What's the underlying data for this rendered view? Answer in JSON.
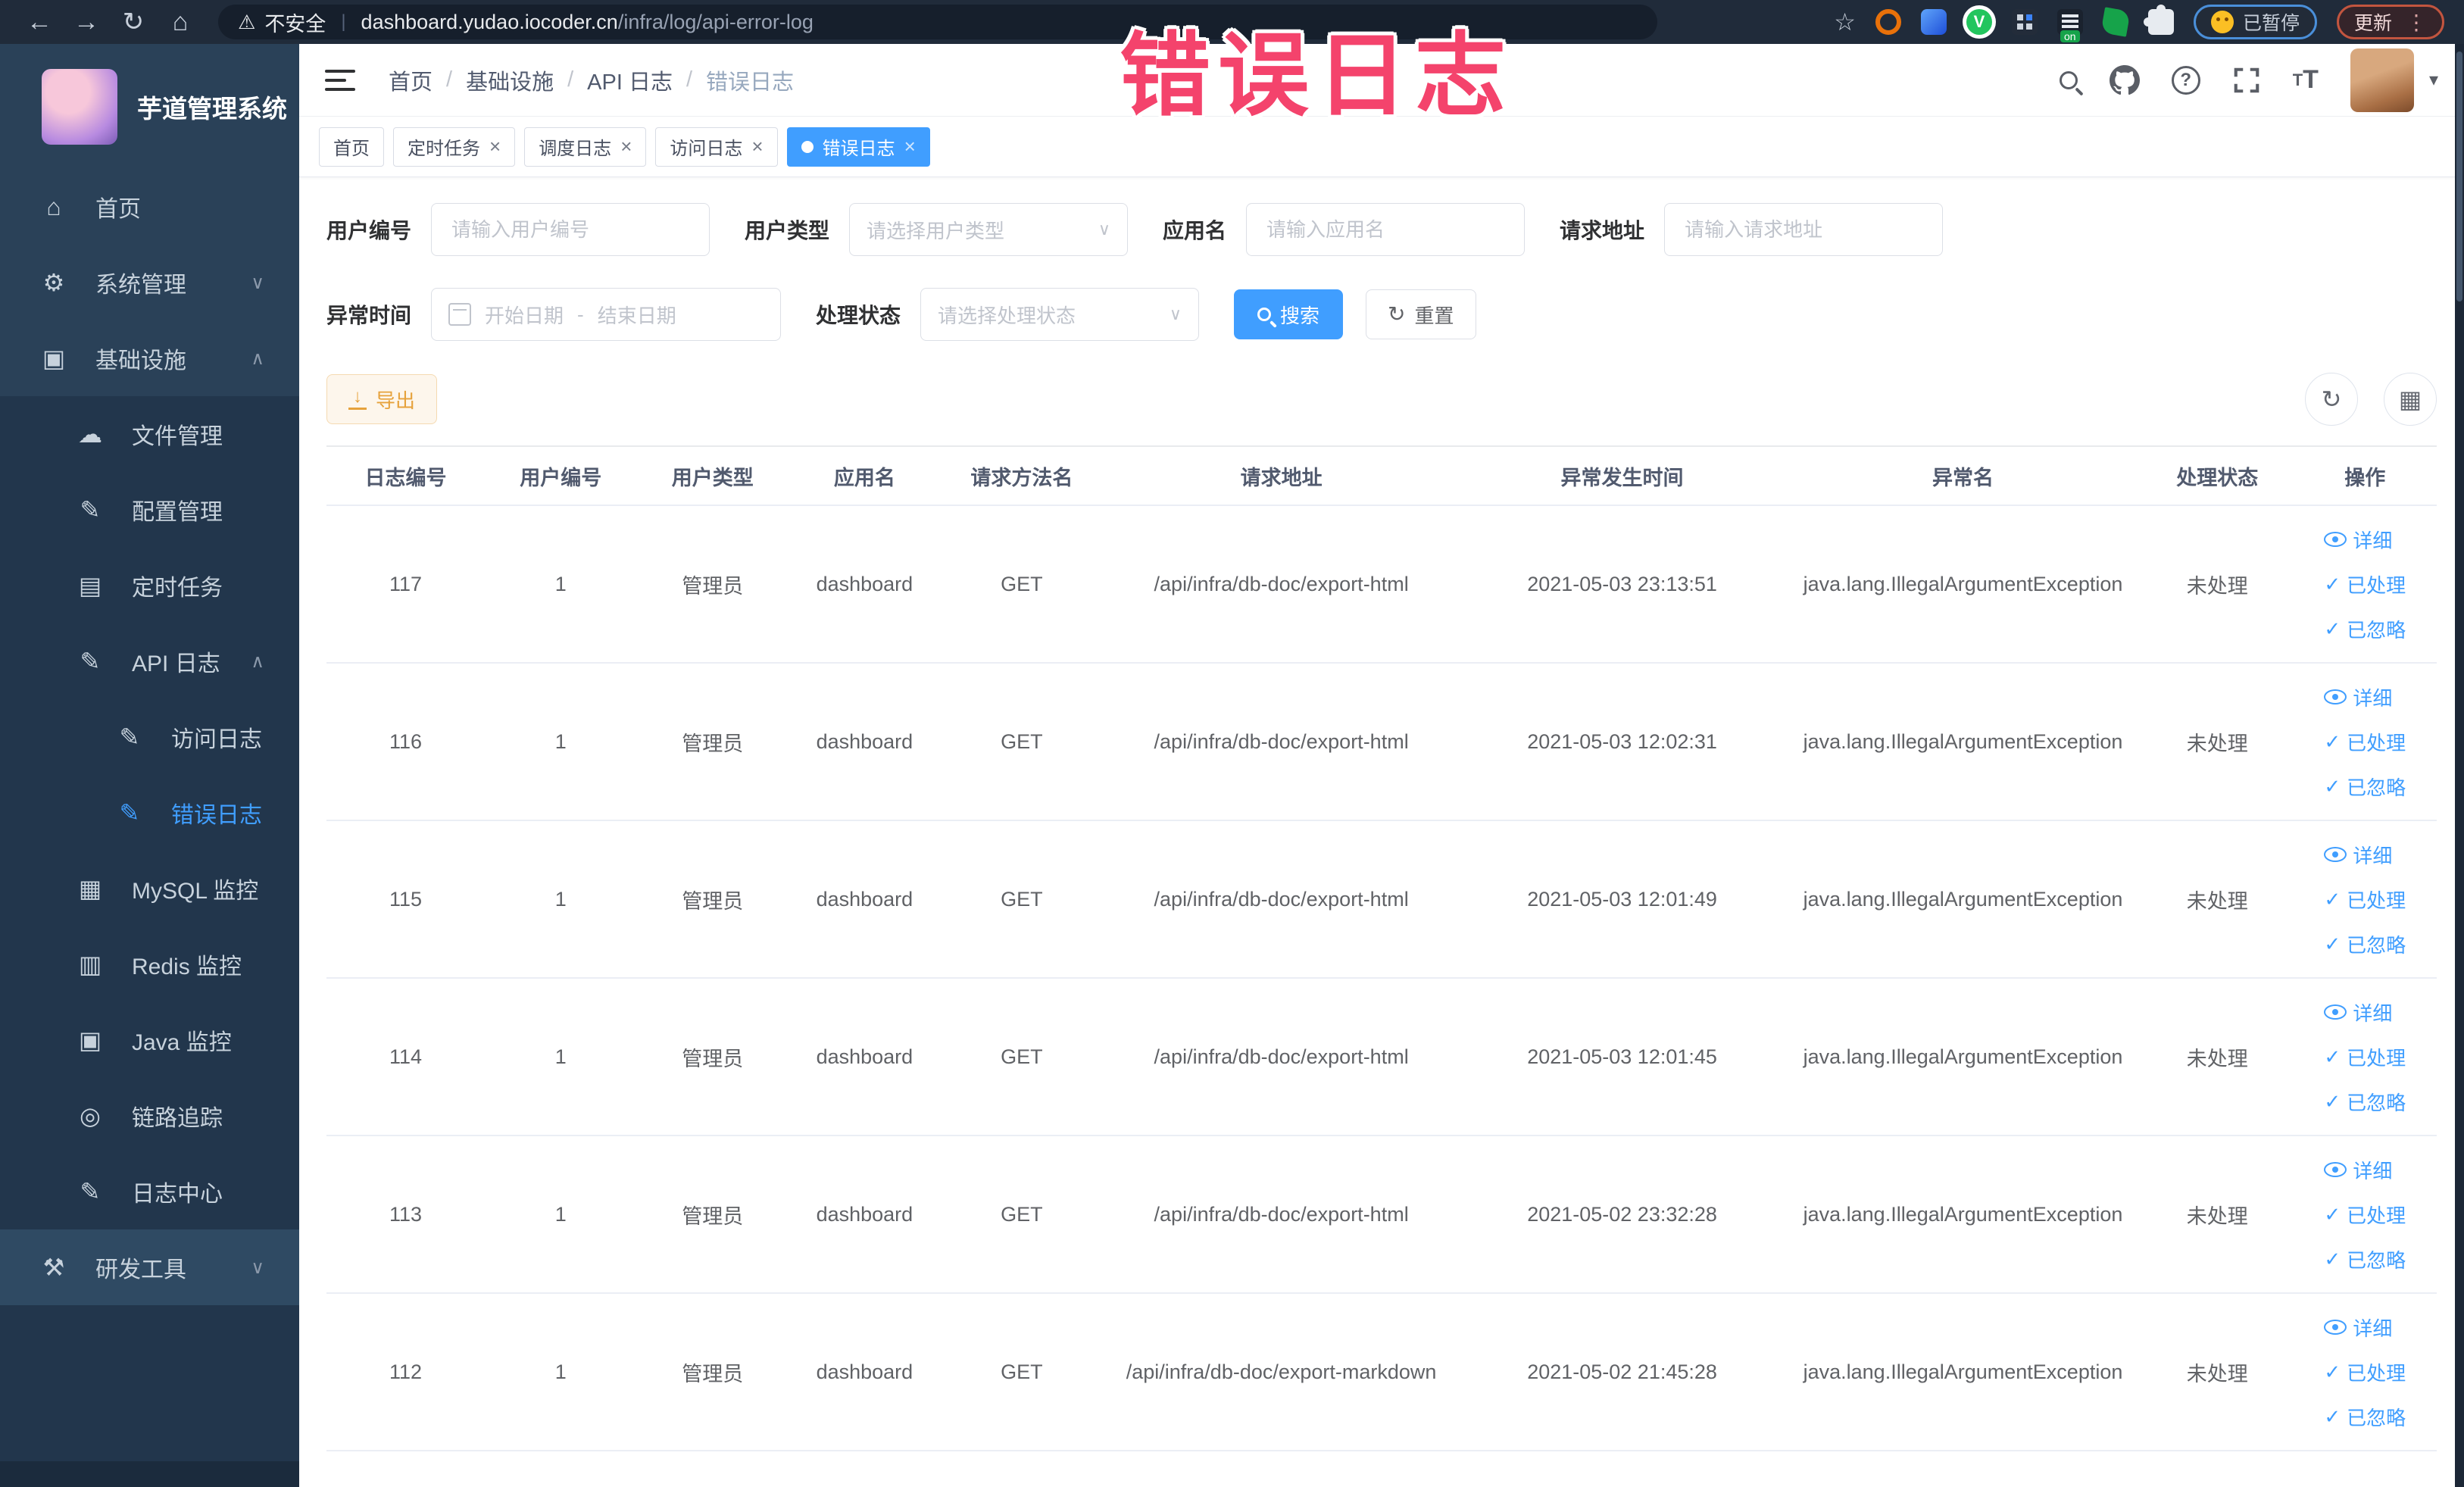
{
  "browser": {
    "security_label": "不安全",
    "url_domain": "dashboard.yudao.iocoder.cn",
    "url_path": "/infra/log/api-error-log",
    "paused_label": "已暂停",
    "update_label": "更新"
  },
  "annotation": {
    "text": "错误日志",
    "color": "#F4436C"
  },
  "sidebar": {
    "app_title": "芋道管理系统",
    "items": [
      {
        "key": "home",
        "label": "首页",
        "icon": "home-icon",
        "depth": 0,
        "chevron": "",
        "active": false
      },
      {
        "key": "system",
        "label": "系统管理",
        "icon": "gear-icon",
        "depth": 0,
        "chevron": "down",
        "active": false
      },
      {
        "key": "infra",
        "label": "基础设施",
        "icon": "infrastructure-icon",
        "depth": 0,
        "chevron": "up",
        "active": false
      },
      {
        "key": "file",
        "label": "文件管理",
        "icon": "file-icon",
        "depth": 1,
        "chevron": "",
        "active": false
      },
      {
        "key": "config",
        "label": "配置管理",
        "icon": "config-icon",
        "depth": 1,
        "chevron": "",
        "active": false
      },
      {
        "key": "job",
        "label": "定时任务",
        "icon": "schedule-icon",
        "depth": 1,
        "chevron": "",
        "active": false
      },
      {
        "key": "api-log",
        "label": "API 日志",
        "icon": "api-log-icon",
        "depth": 1,
        "chevron": "up",
        "active": false
      },
      {
        "key": "access-log",
        "label": "访问日志",
        "icon": "access-log-icon",
        "depth": 2,
        "chevron": "",
        "active": false
      },
      {
        "key": "error-log",
        "label": "错误日志",
        "icon": "error-log-icon",
        "depth": 2,
        "chevron": "",
        "active": true
      },
      {
        "key": "mysql",
        "label": "MySQL 监控",
        "icon": "mysql-icon",
        "depth": 1,
        "chevron": "",
        "active": false
      },
      {
        "key": "redis",
        "label": "Redis 监控",
        "icon": "redis-icon",
        "depth": 1,
        "chevron": "",
        "active": false
      },
      {
        "key": "java",
        "label": "Java 监控",
        "icon": "java-icon",
        "depth": 1,
        "chevron": "",
        "active": false
      },
      {
        "key": "trace",
        "label": "链路追踪",
        "icon": "trace-icon",
        "depth": 1,
        "chevron": "",
        "active": false
      },
      {
        "key": "log-center",
        "label": "日志中心",
        "icon": "log-center-icon",
        "depth": 1,
        "chevron": "",
        "active": false
      },
      {
        "key": "dev-tools",
        "label": "研发工具",
        "icon": "tools-icon",
        "depth": 0,
        "chevron": "down",
        "active": false
      }
    ]
  },
  "navbar": {
    "breadcrumbs": [
      "首页",
      "基础设施",
      "API 日志",
      "错误日志"
    ]
  },
  "tabs": [
    {
      "label": "首页",
      "closable": false,
      "active": false
    },
    {
      "label": "定时任务",
      "closable": true,
      "active": false
    },
    {
      "label": "调度日志",
      "closable": true,
      "active": false
    },
    {
      "label": "访问日志",
      "closable": true,
      "active": false
    },
    {
      "label": "错误日志",
      "closable": true,
      "active": true
    }
  ],
  "filters": {
    "user_id": {
      "label": "用户编号",
      "placeholder": "请输入用户编号"
    },
    "user_type": {
      "label": "用户类型",
      "placeholder": "请选择用户类型"
    },
    "app_name": {
      "label": "应用名",
      "placeholder": "请输入应用名"
    },
    "request_url": {
      "label": "请求地址",
      "placeholder": "请输入请求地址"
    },
    "exception_time": {
      "label": "异常时间",
      "start_placeholder": "开始日期",
      "separator": "-",
      "end_placeholder": "结束日期"
    },
    "process_status": {
      "label": "处理状态",
      "placeholder": "请选择处理状态"
    },
    "search_label": "搜索",
    "reset_label": "重置"
  },
  "toolbar": {
    "export_label": "导出"
  },
  "table": {
    "columns": [
      "日志编号",
      "用户编号",
      "用户类型",
      "应用名",
      "请求方法名",
      "请求地址",
      "异常发生时间",
      "异常名",
      "处理状态",
      "操作"
    ],
    "row_actions": [
      {
        "label": "详细",
        "icon": "eye-icon"
      },
      {
        "label": "已处理",
        "icon": "check-icon"
      },
      {
        "label": "已忽略",
        "icon": "check-icon"
      }
    ],
    "rows": [
      {
        "log_id": "117",
        "user_id": "1",
        "user_type": "管理员",
        "app_name": "dashboard",
        "method": "GET",
        "url": "/api/infra/db-doc/export-html",
        "time": "2021-05-03 23:13:51",
        "exception": "java.lang.IllegalArgumentException",
        "status": "未处理"
      },
      {
        "log_id": "116",
        "user_id": "1",
        "user_type": "管理员",
        "app_name": "dashboard",
        "method": "GET",
        "url": "/api/infra/db-doc/export-html",
        "time": "2021-05-03 12:02:31",
        "exception": "java.lang.IllegalArgumentException",
        "status": "未处理"
      },
      {
        "log_id": "115",
        "user_id": "1",
        "user_type": "管理员",
        "app_name": "dashboard",
        "method": "GET",
        "url": "/api/infra/db-doc/export-html",
        "time": "2021-05-03 12:01:49",
        "exception": "java.lang.IllegalArgumentException",
        "status": "未处理"
      },
      {
        "log_id": "114",
        "user_id": "1",
        "user_type": "管理员",
        "app_name": "dashboard",
        "method": "GET",
        "url": "/api/infra/db-doc/export-html",
        "time": "2021-05-03 12:01:45",
        "exception": "java.lang.IllegalArgumentException",
        "status": "未处理"
      },
      {
        "log_id": "113",
        "user_id": "1",
        "user_type": "管理员",
        "app_name": "dashboard",
        "method": "GET",
        "url": "/api/infra/db-doc/export-html",
        "time": "2021-05-02 23:32:28",
        "exception": "java.lang.IllegalArgumentException",
        "status": "未处理"
      },
      {
        "log_id": "112",
        "user_id": "1",
        "user_type": "管理员",
        "app_name": "dashboard",
        "method": "GET",
        "url": "/api/infra/db-doc/export-markdown",
        "time": "2021-05-02 21:45:28",
        "exception": "java.lang.IllegalArgumentException",
        "status": "未处理"
      }
    ]
  },
  "colors": {
    "primary": "#409EFF",
    "warning": "#E6A23C",
    "annotation_pink": "#F4436C",
    "sidebar_bg": "#2A4158",
    "submenu_bg": "#22364C",
    "chrome_bg": "#202B3A"
  }
}
